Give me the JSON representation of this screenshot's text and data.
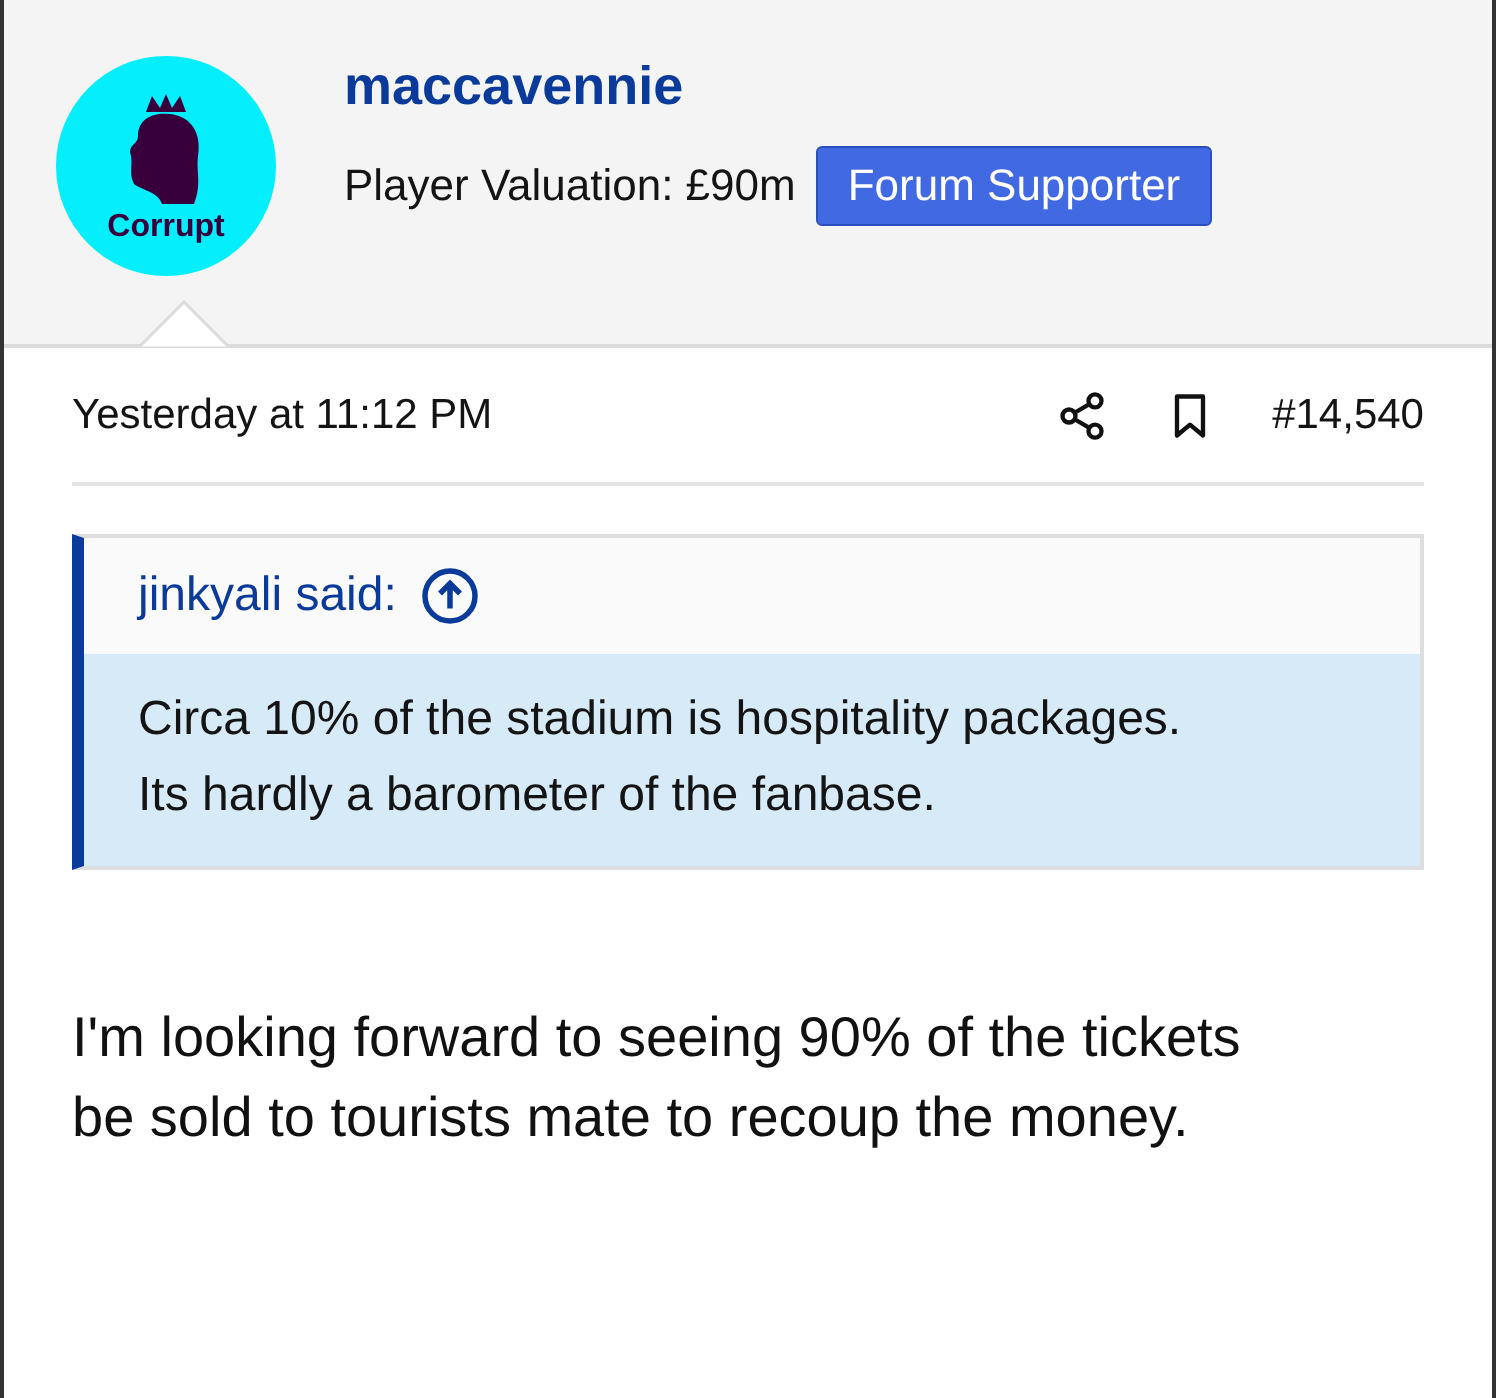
{
  "author": {
    "avatar_text": "Corrupt",
    "username": "maccavennie",
    "valuation": "Player Valuation: £90m",
    "badge": "Forum Supporter"
  },
  "post_meta": {
    "time": "Yesterday at 11:12 PM",
    "number": "#14,540"
  },
  "quote": {
    "author": "jinkyali said:",
    "lines": [
      "Circa 10% of the stadium is hospitality packages.",
      "Its hardly a barometer of the fanbase."
    ]
  },
  "message": "I'm looking forward to seeing 90% of the tickets be sold to tourists mate to recoup the money."
}
